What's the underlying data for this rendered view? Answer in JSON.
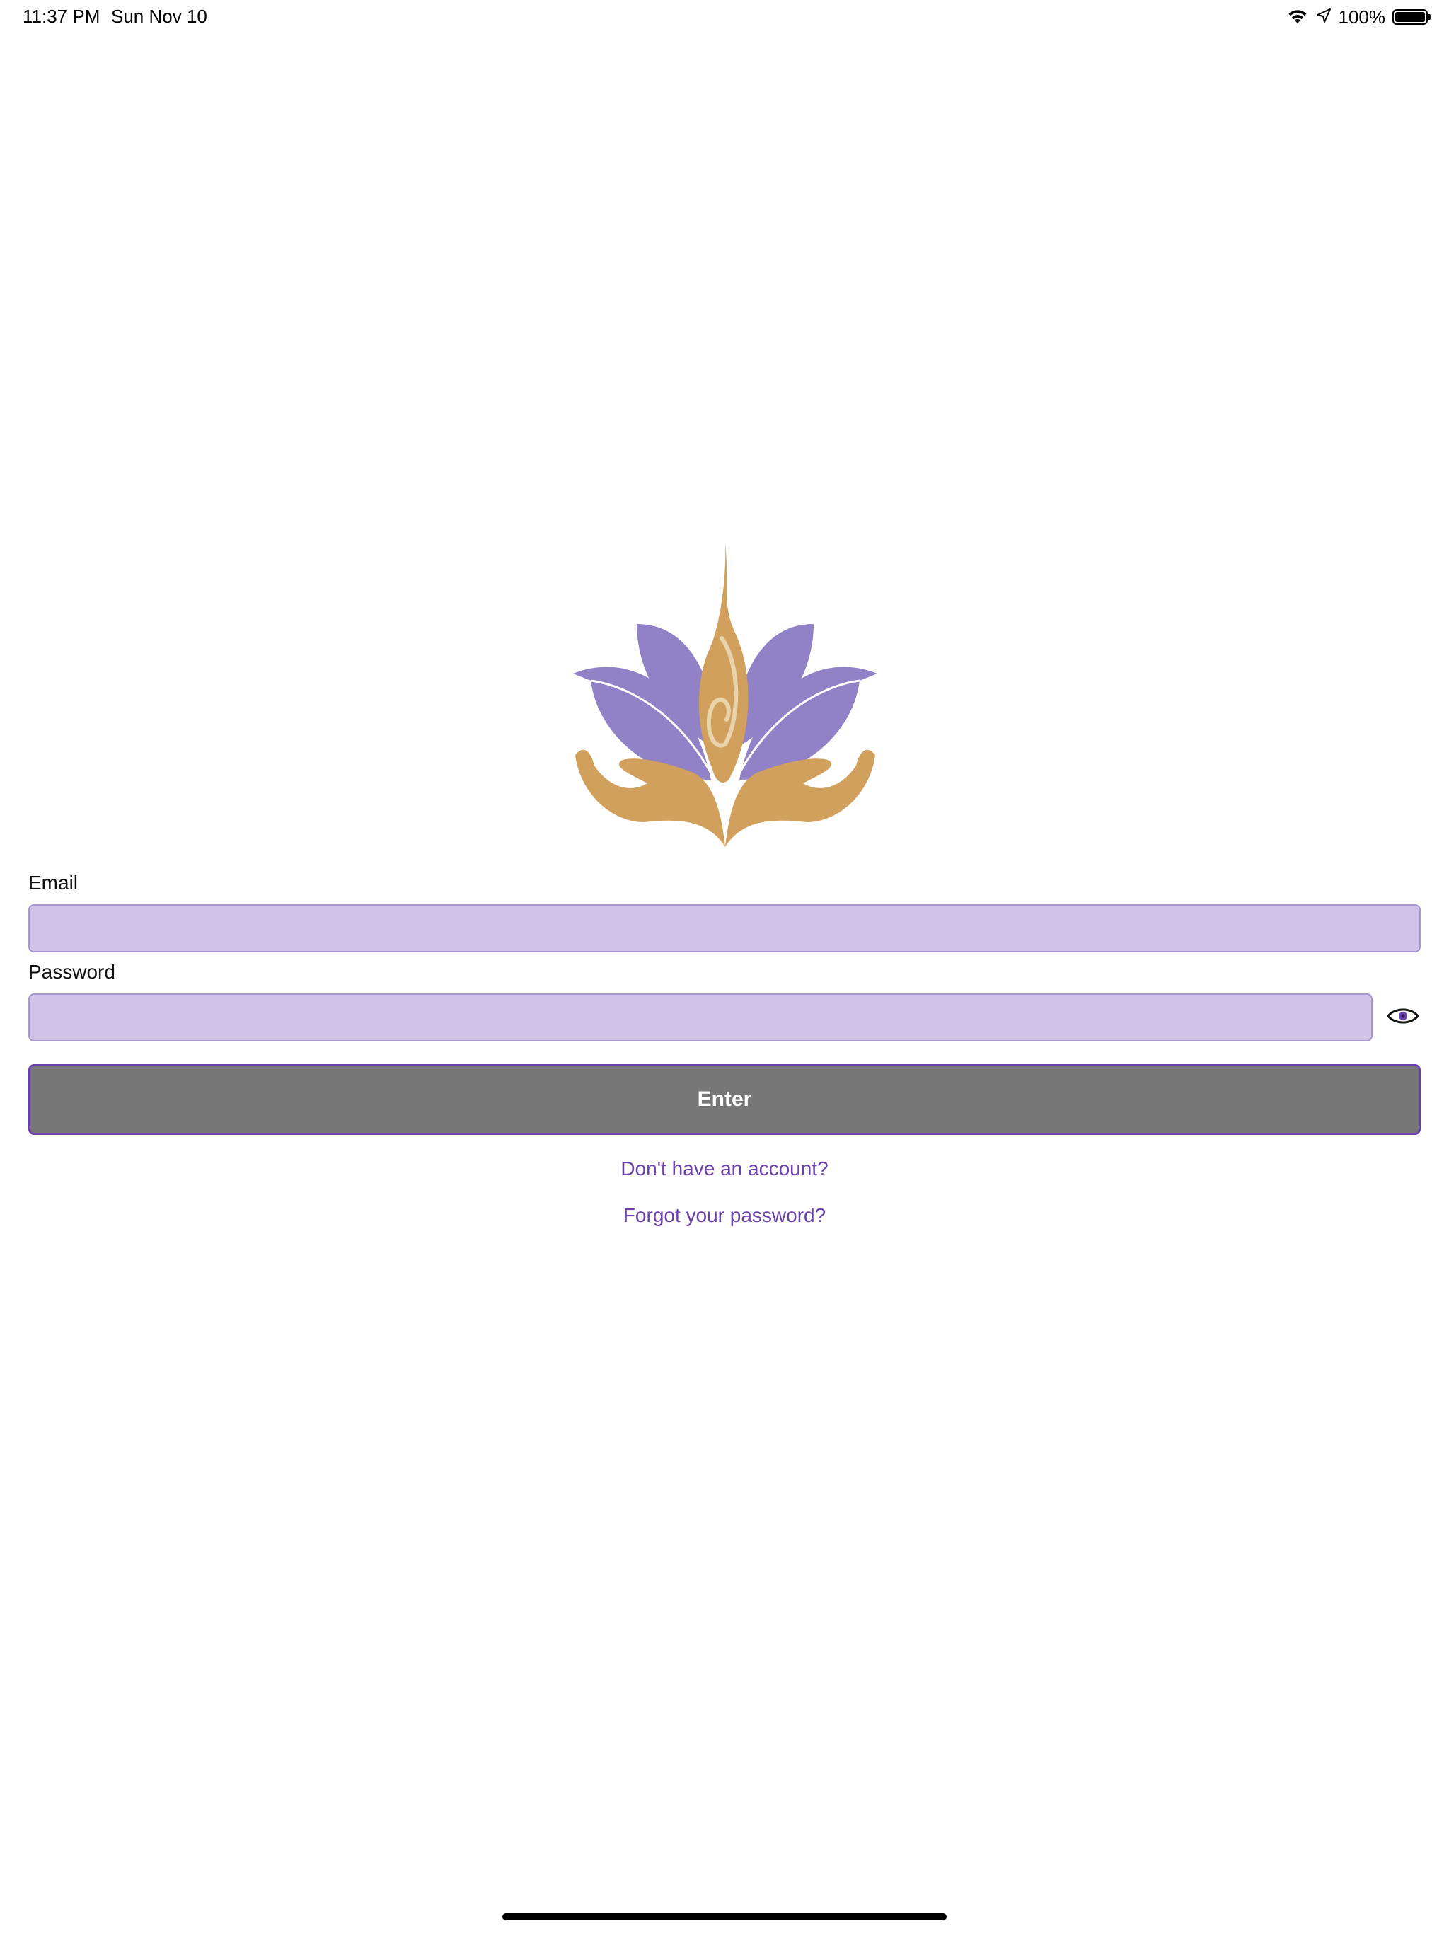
{
  "status_bar": {
    "time": "11:37 PM",
    "date": "Sun Nov 10",
    "battery_percent": "100%",
    "battery_level": 1.0
  },
  "logo": {
    "icon": "lotus-hands-logo-icon",
    "colors": {
      "petal": "#9181c6",
      "gold": "#d1a05c"
    }
  },
  "form": {
    "email_label": "Email",
    "email_value": "",
    "password_label": "Password",
    "password_value": "",
    "show_password_icon": "eye-icon",
    "enter_label": "Enter",
    "signup_link": "Don't have an account?",
    "forgot_link": "Forgot your password?"
  },
  "colors": {
    "field_background": "#d0c3e8",
    "field_border": "#a796cf",
    "button_background": "#777777",
    "accent": "#6a3fb0"
  }
}
